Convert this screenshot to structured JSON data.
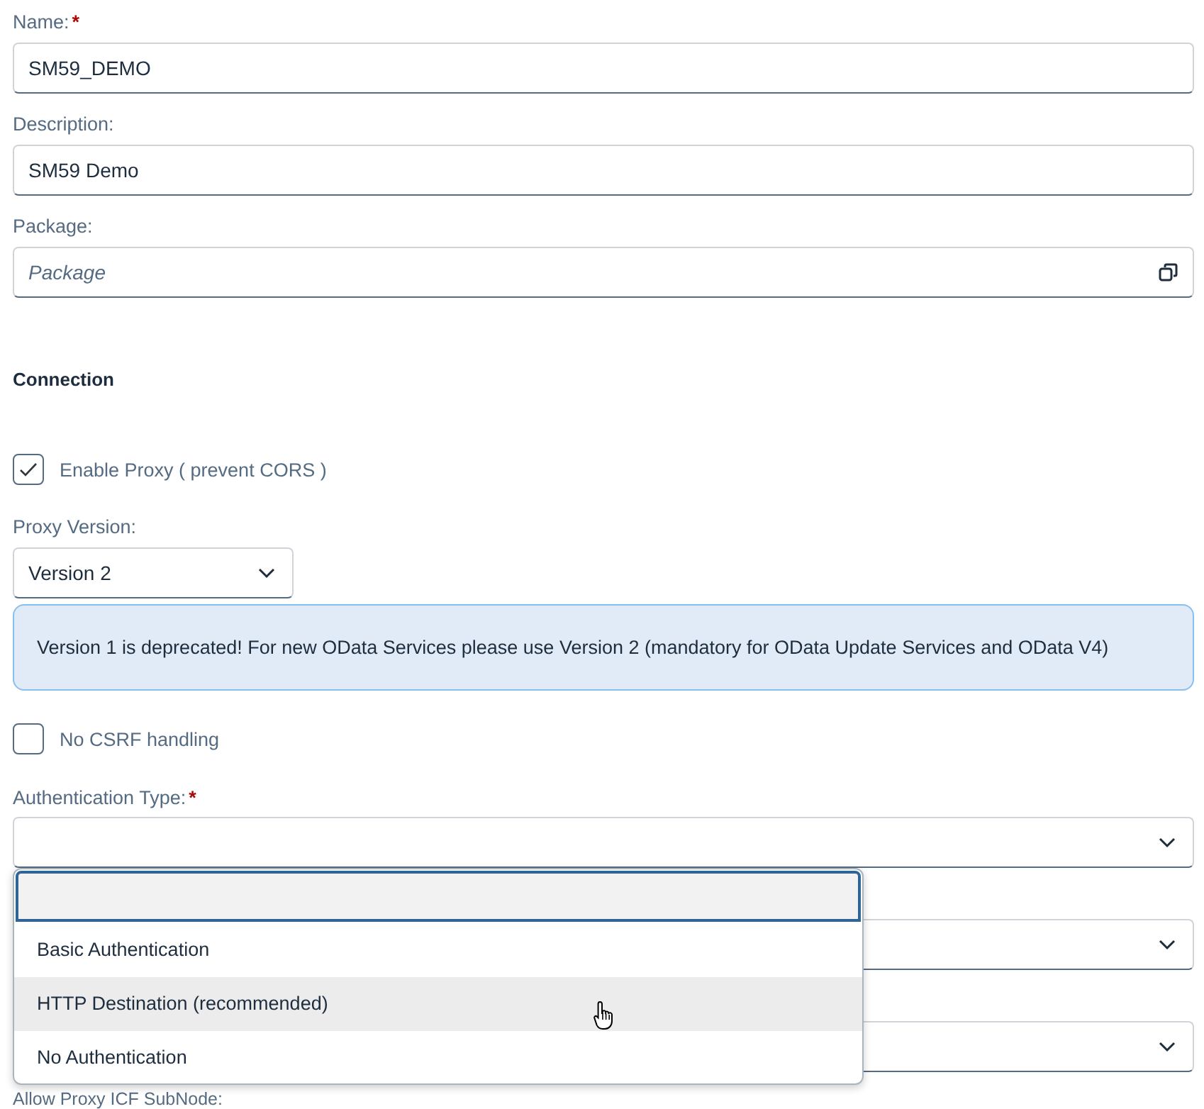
{
  "fields": [
    {
      "label": "Name:",
      "required_mark": "*",
      "value": "SM59_DEMO",
      "kind": "text"
    },
    {
      "label": "Description:",
      "value": "SM59 Demo",
      "kind": "text"
    },
    {
      "label": "Package:",
      "placeholder": "Package",
      "kind": "valuehelp"
    }
  ],
  "section_title": "Connection",
  "enable_proxy": {
    "label": "Enable Proxy ( prevent CORS )",
    "checked": true
  },
  "proxy_version": {
    "label": "Proxy Version:",
    "value": "Version 2"
  },
  "info_message": "Version 1 is deprecated! For new OData Services please use Version 2 (mandatory for OData Update Services and OData V4)",
  "no_csrf": {
    "label": "No CSRF handling",
    "checked": false
  },
  "authentication_type": {
    "label": "Authentication Type:",
    "required_mark": "*"
  },
  "dropdown": {
    "options": [
      {
        "label": "Basic Authentication",
        "highlighted": false
      },
      {
        "label": "HTTP Destination (recommended)",
        "highlighted": true
      },
      {
        "label": "No Authentication",
        "highlighted": false
      }
    ]
  },
  "cut_label": "Allow Proxy ICF SubNode:"
}
